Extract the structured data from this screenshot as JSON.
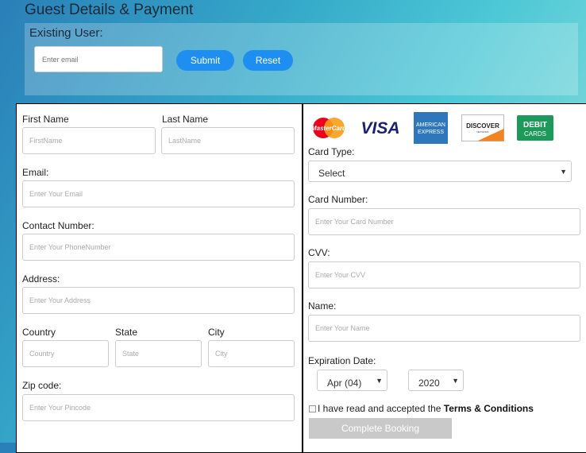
{
  "page": {
    "title": "Guest Details & Payment"
  },
  "existing": {
    "label": "Existing User:",
    "email_placeholder": "Enter email",
    "submit_label": "Submit",
    "reset_label": "Reset"
  },
  "guest": {
    "first_name_label": "First Name",
    "first_name_placeholder": "FirstName",
    "last_name_label": "Last Name",
    "last_name_placeholder": "LastName",
    "email_label": "Email:",
    "email_placeholder": "Enter Your Email",
    "contact_label": "Contact Number:",
    "contact_placeholder": "Enter Your PhoneNumber",
    "address_label": "Address:",
    "address_placeholder": "Enter Your Address",
    "country_label": "Country",
    "country_placeholder": "Country",
    "state_label": "State",
    "state_placeholder": "State",
    "city_label": "City",
    "city_placeholder": "City",
    "zip_label": "Zip code:",
    "zip_placeholder": "Enter Your Pincode"
  },
  "payment": {
    "logos": [
      "MasterCard",
      "VISA",
      "AMERICAN EXPRESS",
      "DISCOVER",
      "DEBIT CARDS"
    ],
    "discover_sub": "NETWORK",
    "card_type_label": "Card Type:",
    "card_type_value": "Select",
    "card_number_label": "Card Number:",
    "card_number_placeholder": "Enter Your Card Number",
    "cvv_label": "CVV:",
    "cvv_placeholder": "Enter Your CVV",
    "name_label": "Name:",
    "name_placeholder": "Enter Your Name",
    "expiration_label": "Expiration Date:",
    "month_value": "Apr (04)",
    "year_value": "2020",
    "terms_text": "I have read and accepted the ",
    "terms_link": "Terms & Conditions",
    "complete_label": "Complete Booking"
  },
  "colors": {
    "accent": "#1e8ff0",
    "disabled_button": "#c9c9c9",
    "mastercard_red": "#eb001b",
    "mastercard_orange": "#f79e1b",
    "visa_blue": "#1a1f71",
    "amex_blue": "#2e77bb",
    "discover_orange": "#f58220",
    "debit_green": "#1d9a5a"
  }
}
